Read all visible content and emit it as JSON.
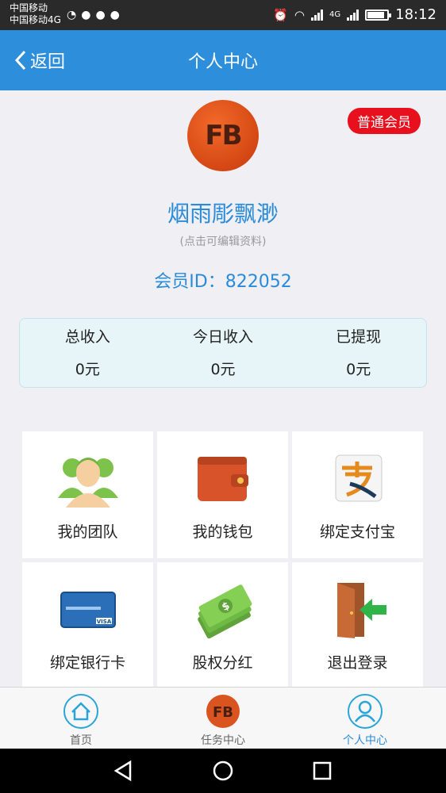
{
  "status_bar": {
    "carrier_line1": "中国移动",
    "carrier_line2": "中国移动4G",
    "time": "18:12",
    "net_label": "4G"
  },
  "header": {
    "back_label": "返回",
    "title": "个人中心"
  },
  "profile": {
    "badge": "普通会员",
    "avatar_text": "FB",
    "nickname": "烟雨彫飘渺",
    "edit_hint": "(点击可编辑资料)",
    "member_id": "会员ID：822052"
  },
  "stats": [
    {
      "label": "总收入",
      "value": "0元"
    },
    {
      "label": "今日收入",
      "value": "0元"
    },
    {
      "label": "已提现",
      "value": "0元"
    }
  ],
  "menu": [
    {
      "label": "我的团队",
      "icon": "team-icon"
    },
    {
      "label": "我的钱包",
      "icon": "wallet-icon"
    },
    {
      "label": "绑定支付宝",
      "icon": "alipay-icon"
    },
    {
      "label": "绑定银行卡",
      "icon": "bank-card-icon"
    },
    {
      "label": "股权分红",
      "icon": "money-icon"
    },
    {
      "label": "退出登录",
      "icon": "logout-door-icon"
    }
  ],
  "bottom_nav": [
    {
      "label": "首页",
      "icon": "home-icon"
    },
    {
      "label": "任务中心",
      "icon": "fb-logo-icon"
    },
    {
      "label": "个人中心",
      "icon": "user-icon",
      "active": true
    }
  ],
  "colors": {
    "primary": "#2d8fdc",
    "badge": "#e8101c",
    "background": "#efeff4"
  }
}
